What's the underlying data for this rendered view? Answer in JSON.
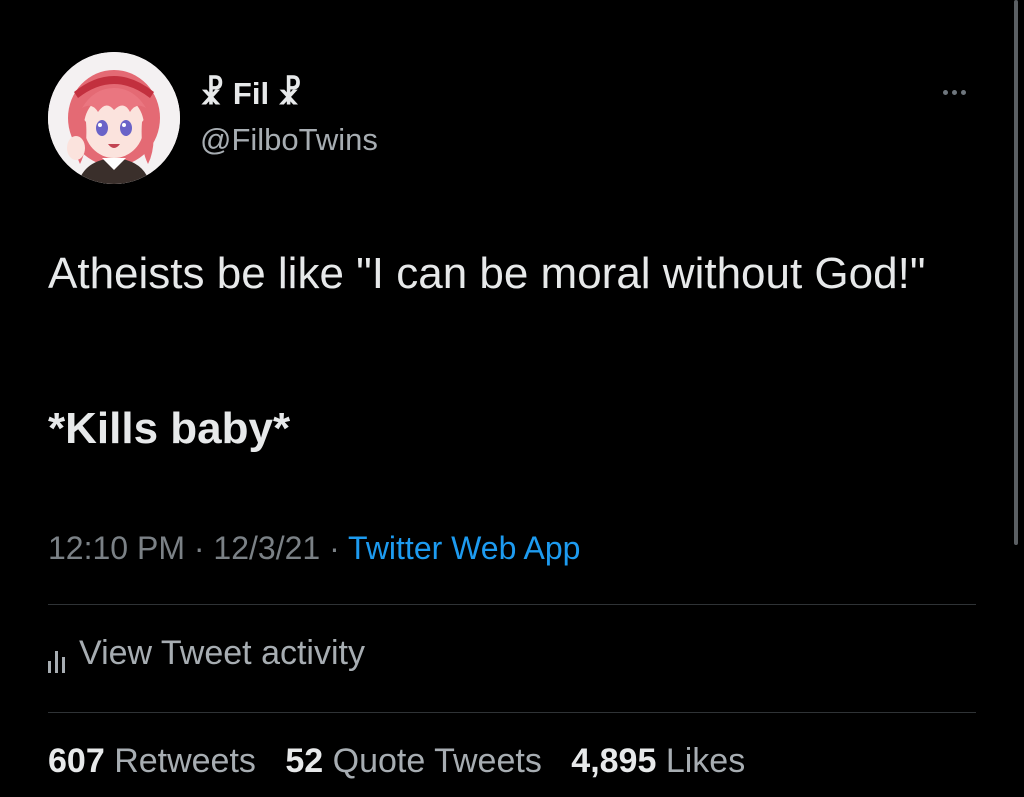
{
  "tweet": {
    "author": {
      "display_name": "☧ Fil ☧",
      "handle": "@FilboTwins",
      "avatar_icon": "anime-girl-avatar"
    },
    "more_icon": "more-horizontal-icon",
    "text": "Atheists be like \"I can be moral without God!\"",
    "action_text": "*Kills baby*",
    "meta": {
      "time": "12:10 PM",
      "separator": "·",
      "date": "12/3/21",
      "source": "Twitter Web App"
    },
    "activity": {
      "icon": "analytics-icon",
      "label": "View Tweet activity"
    },
    "stats": [
      {
        "count": "607",
        "label": "Retweets"
      },
      {
        "count": "52",
        "label": "Quote Tweets"
      },
      {
        "count": "4,895",
        "label": "Likes"
      }
    ]
  },
  "colors": {
    "background": "#000000",
    "text_primary": "#e7e9ea",
    "text_secondary": "#a7adb2",
    "link": "#1d9bf0",
    "divider": "#2f3336"
  }
}
